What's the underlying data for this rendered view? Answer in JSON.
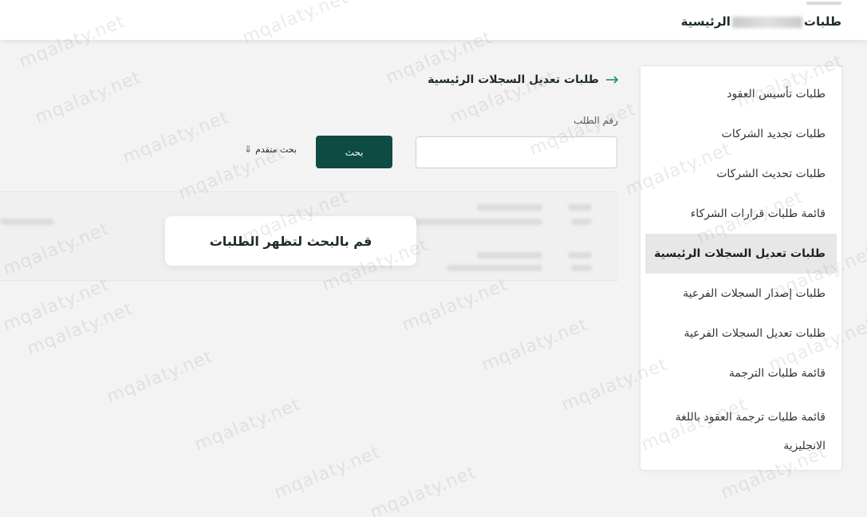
{
  "header": {
    "title_start": "طلبات",
    "title_end": "الرئيسية"
  },
  "sidebar": {
    "items": [
      {
        "label": "طلبات تأسيس العقود"
      },
      {
        "label": "طلبات تجديد الشركات"
      },
      {
        "label": "طلبات تحديث الشركات"
      },
      {
        "label": "قائمة طلبات قرارات الشركاء"
      },
      {
        "label": "طلبات تعديل السجلات الرئيسية",
        "active": true
      },
      {
        "label": "طلبات إصدار السجلات الفرعية"
      },
      {
        "label": "طلبات تعديل السجلات الفرعية"
      },
      {
        "label": "قائمة طلبات الترجمة"
      },
      {
        "label": "قائمة طلبات ترجمة العقود باللغة الانجليزية"
      }
    ]
  },
  "main": {
    "page_title": "طلبات تعديل السجلات الرئيسية",
    "back_icon": "arrow-right-icon",
    "request_number_label": "رقم الطلب",
    "request_number_value": "",
    "search_button_label": "بحث",
    "advanced_search_label": "بحث متقدم",
    "advanced_icon": "double-chevron-down-icon",
    "empty_state_message": "قم بالبحث لتظهر الطلبات"
  },
  "watermark": {
    "text": "mqalaty.net"
  },
  "colors": {
    "primary": "#0d4b43",
    "accent_arrow": "#1a8c7a",
    "active_bg": "#e7e7e7",
    "background": "#f3f3f3"
  }
}
